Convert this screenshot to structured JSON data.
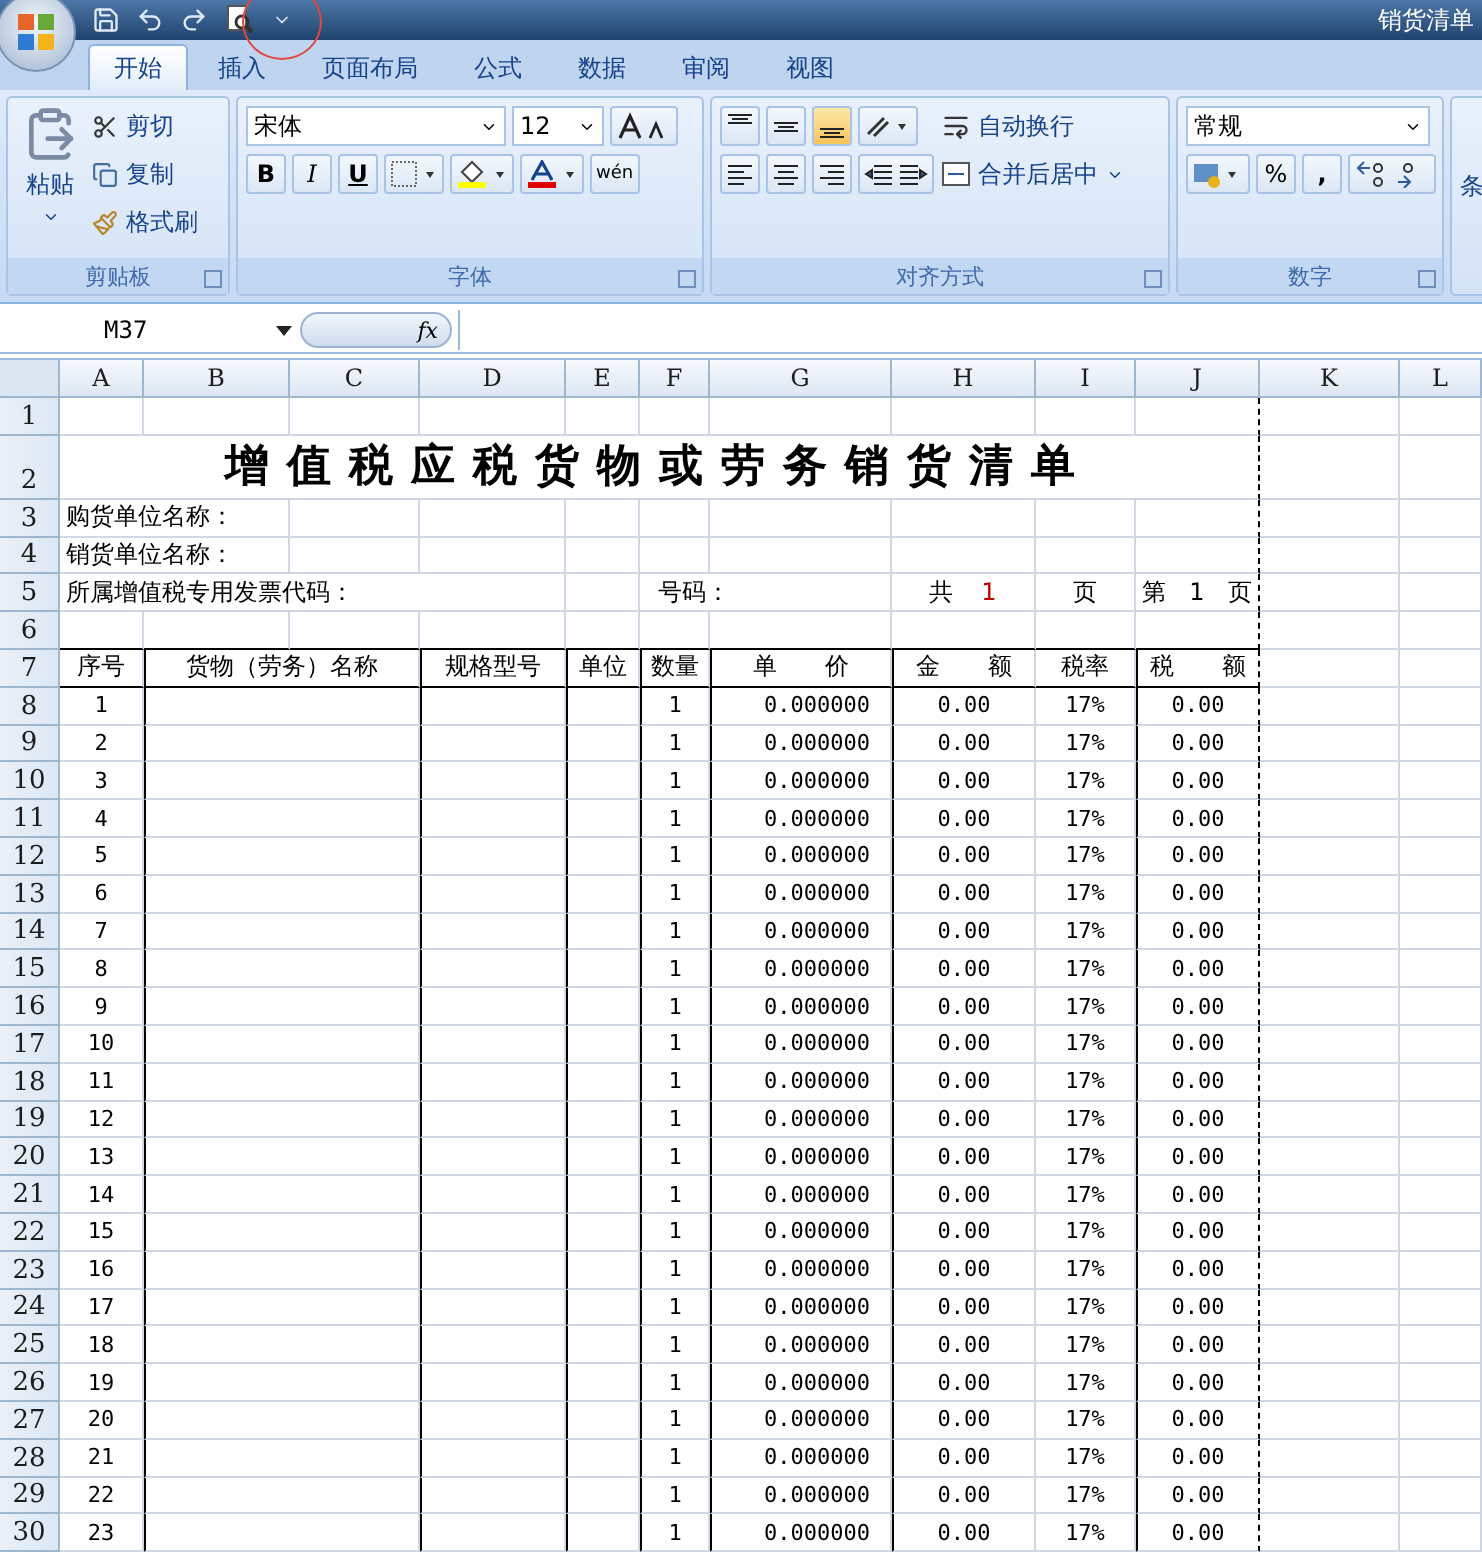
{
  "window": {
    "title": "销货清单"
  },
  "tabs": [
    {
      "label": "开始",
      "selected": true
    },
    {
      "label": "插入",
      "selected": false
    },
    {
      "label": "页面布局",
      "selected": false
    },
    {
      "label": "公式",
      "selected": false
    },
    {
      "label": "数据",
      "selected": false
    },
    {
      "label": "审阅",
      "selected": false
    },
    {
      "label": "视图",
      "selected": false
    }
  ],
  "ribbon": {
    "clipboard": {
      "label": "剪贴板",
      "paste": "粘贴",
      "cut": "剪切",
      "copy": "复制",
      "format_painter": "格式刷"
    },
    "font": {
      "label": "字体",
      "name": "宋体",
      "size": "12",
      "bold": "B",
      "italic": "I",
      "underline": "U",
      "phonetic": "wén"
    },
    "alignment": {
      "label": "对齐方式",
      "vertical": [
        {
          "kind": "top",
          "selected": false
        },
        {
          "kind": "middle",
          "selected": false
        },
        {
          "kind": "bottom",
          "selected": true
        }
      ],
      "wrap": "自动换行",
      "merge": "合并后居中"
    },
    "number": {
      "label": "数字",
      "format": "常规",
      "percent": "%",
      "comma": ","
    },
    "cut_group": "条"
  },
  "formula_bar": {
    "name_box": "M37",
    "fx": "fx"
  },
  "columns": [
    "A",
    "B",
    "C",
    "D",
    "E",
    "F",
    "G",
    "H",
    "I",
    "J",
    "K",
    "L"
  ],
  "row_headers": [
    "1",
    "2",
    "3",
    "4",
    "5",
    "6",
    "7",
    "8",
    "9",
    "10",
    "11",
    "12",
    "13",
    "14",
    "15",
    "16",
    "17",
    "18",
    "19",
    "20",
    "21",
    "22",
    "23",
    "24",
    "25",
    "26",
    "27",
    "28",
    "29",
    "30"
  ],
  "sheet": {
    "title": "增值税应税货物或劳务销货清单",
    "buyer_label": "购货单位名称：",
    "seller_label": "销货单位名称：",
    "invoice_code_label": "所属增值税专用发票代码：",
    "number_label": "号码：",
    "total_label": "共",
    "total_pages": "1",
    "total_unit": "页",
    "page_label": "第",
    "page_number": "1",
    "page_unit": "页",
    "headers": [
      "序号",
      "货物（劳务）名称",
      "规格型号",
      "单位",
      "数量",
      "单　　价",
      "金　　额",
      "税率",
      "税　　额"
    ],
    "rows": [
      {
        "seq": "1",
        "quantity": "1",
        "unit_price": "0.000000",
        "amount": "0.00",
        "tax_rate": "17%",
        "tax": "0.00"
      },
      {
        "seq": "2",
        "quantity": "1",
        "unit_price": "0.000000",
        "amount": "0.00",
        "tax_rate": "17%",
        "tax": "0.00"
      },
      {
        "seq": "3",
        "quantity": "1",
        "unit_price": "0.000000",
        "amount": "0.00",
        "tax_rate": "17%",
        "tax": "0.00"
      },
      {
        "seq": "4",
        "quantity": "1",
        "unit_price": "0.000000",
        "amount": "0.00",
        "tax_rate": "17%",
        "tax": "0.00"
      },
      {
        "seq": "5",
        "quantity": "1",
        "unit_price": "0.000000",
        "amount": "0.00",
        "tax_rate": "17%",
        "tax": "0.00"
      },
      {
        "seq": "6",
        "quantity": "1",
        "unit_price": "0.000000",
        "amount": "0.00",
        "tax_rate": "17%",
        "tax": "0.00"
      },
      {
        "seq": "7",
        "quantity": "1",
        "unit_price": "0.000000",
        "amount": "0.00",
        "tax_rate": "17%",
        "tax": "0.00"
      },
      {
        "seq": "8",
        "quantity": "1",
        "unit_price": "0.000000",
        "amount": "0.00",
        "tax_rate": "17%",
        "tax": "0.00"
      },
      {
        "seq": "9",
        "quantity": "1",
        "unit_price": "0.000000",
        "amount": "0.00",
        "tax_rate": "17%",
        "tax": "0.00"
      },
      {
        "seq": "10",
        "quantity": "1",
        "unit_price": "0.000000",
        "amount": "0.00",
        "tax_rate": "17%",
        "tax": "0.00"
      },
      {
        "seq": "11",
        "quantity": "1",
        "unit_price": "0.000000",
        "amount": "0.00",
        "tax_rate": "17%",
        "tax": "0.00"
      },
      {
        "seq": "12",
        "quantity": "1",
        "unit_price": "0.000000",
        "amount": "0.00",
        "tax_rate": "17%",
        "tax": "0.00"
      },
      {
        "seq": "13",
        "quantity": "1",
        "unit_price": "0.000000",
        "amount": "0.00",
        "tax_rate": "17%",
        "tax": "0.00"
      },
      {
        "seq": "14",
        "quantity": "1",
        "unit_price": "0.000000",
        "amount": "0.00",
        "tax_rate": "17%",
        "tax": "0.00"
      },
      {
        "seq": "15",
        "quantity": "1",
        "unit_price": "0.000000",
        "amount": "0.00",
        "tax_rate": "17%",
        "tax": "0.00"
      },
      {
        "seq": "16",
        "quantity": "1",
        "unit_price": "0.000000",
        "amount": "0.00",
        "tax_rate": "17%",
        "tax": "0.00"
      },
      {
        "seq": "17",
        "quantity": "1",
        "unit_price": "0.000000",
        "amount": "0.00",
        "tax_rate": "17%",
        "tax": "0.00"
      },
      {
        "seq": "18",
        "quantity": "1",
        "unit_price": "0.000000",
        "amount": "0.00",
        "tax_rate": "17%",
        "tax": "0.00"
      },
      {
        "seq": "19",
        "quantity": "1",
        "unit_price": "0.000000",
        "amount": "0.00",
        "tax_rate": "17%",
        "tax": "0.00"
      },
      {
        "seq": "20",
        "quantity": "1",
        "unit_price": "0.000000",
        "amount": "0.00",
        "tax_rate": "17%",
        "tax": "0.00"
      },
      {
        "seq": "21",
        "quantity": "1",
        "unit_price": "0.000000",
        "amount": "0.00",
        "tax_rate": "17%",
        "tax": "0.00"
      },
      {
        "seq": "22",
        "quantity": "1",
        "unit_price": "0.000000",
        "amount": "0.00",
        "tax_rate": "17%",
        "tax": "0.00"
      },
      {
        "seq": "23",
        "quantity": "1",
        "unit_price": "0.000000",
        "amount": "0.00",
        "tax_rate": "17%",
        "tax": "0.00"
      }
    ]
  }
}
